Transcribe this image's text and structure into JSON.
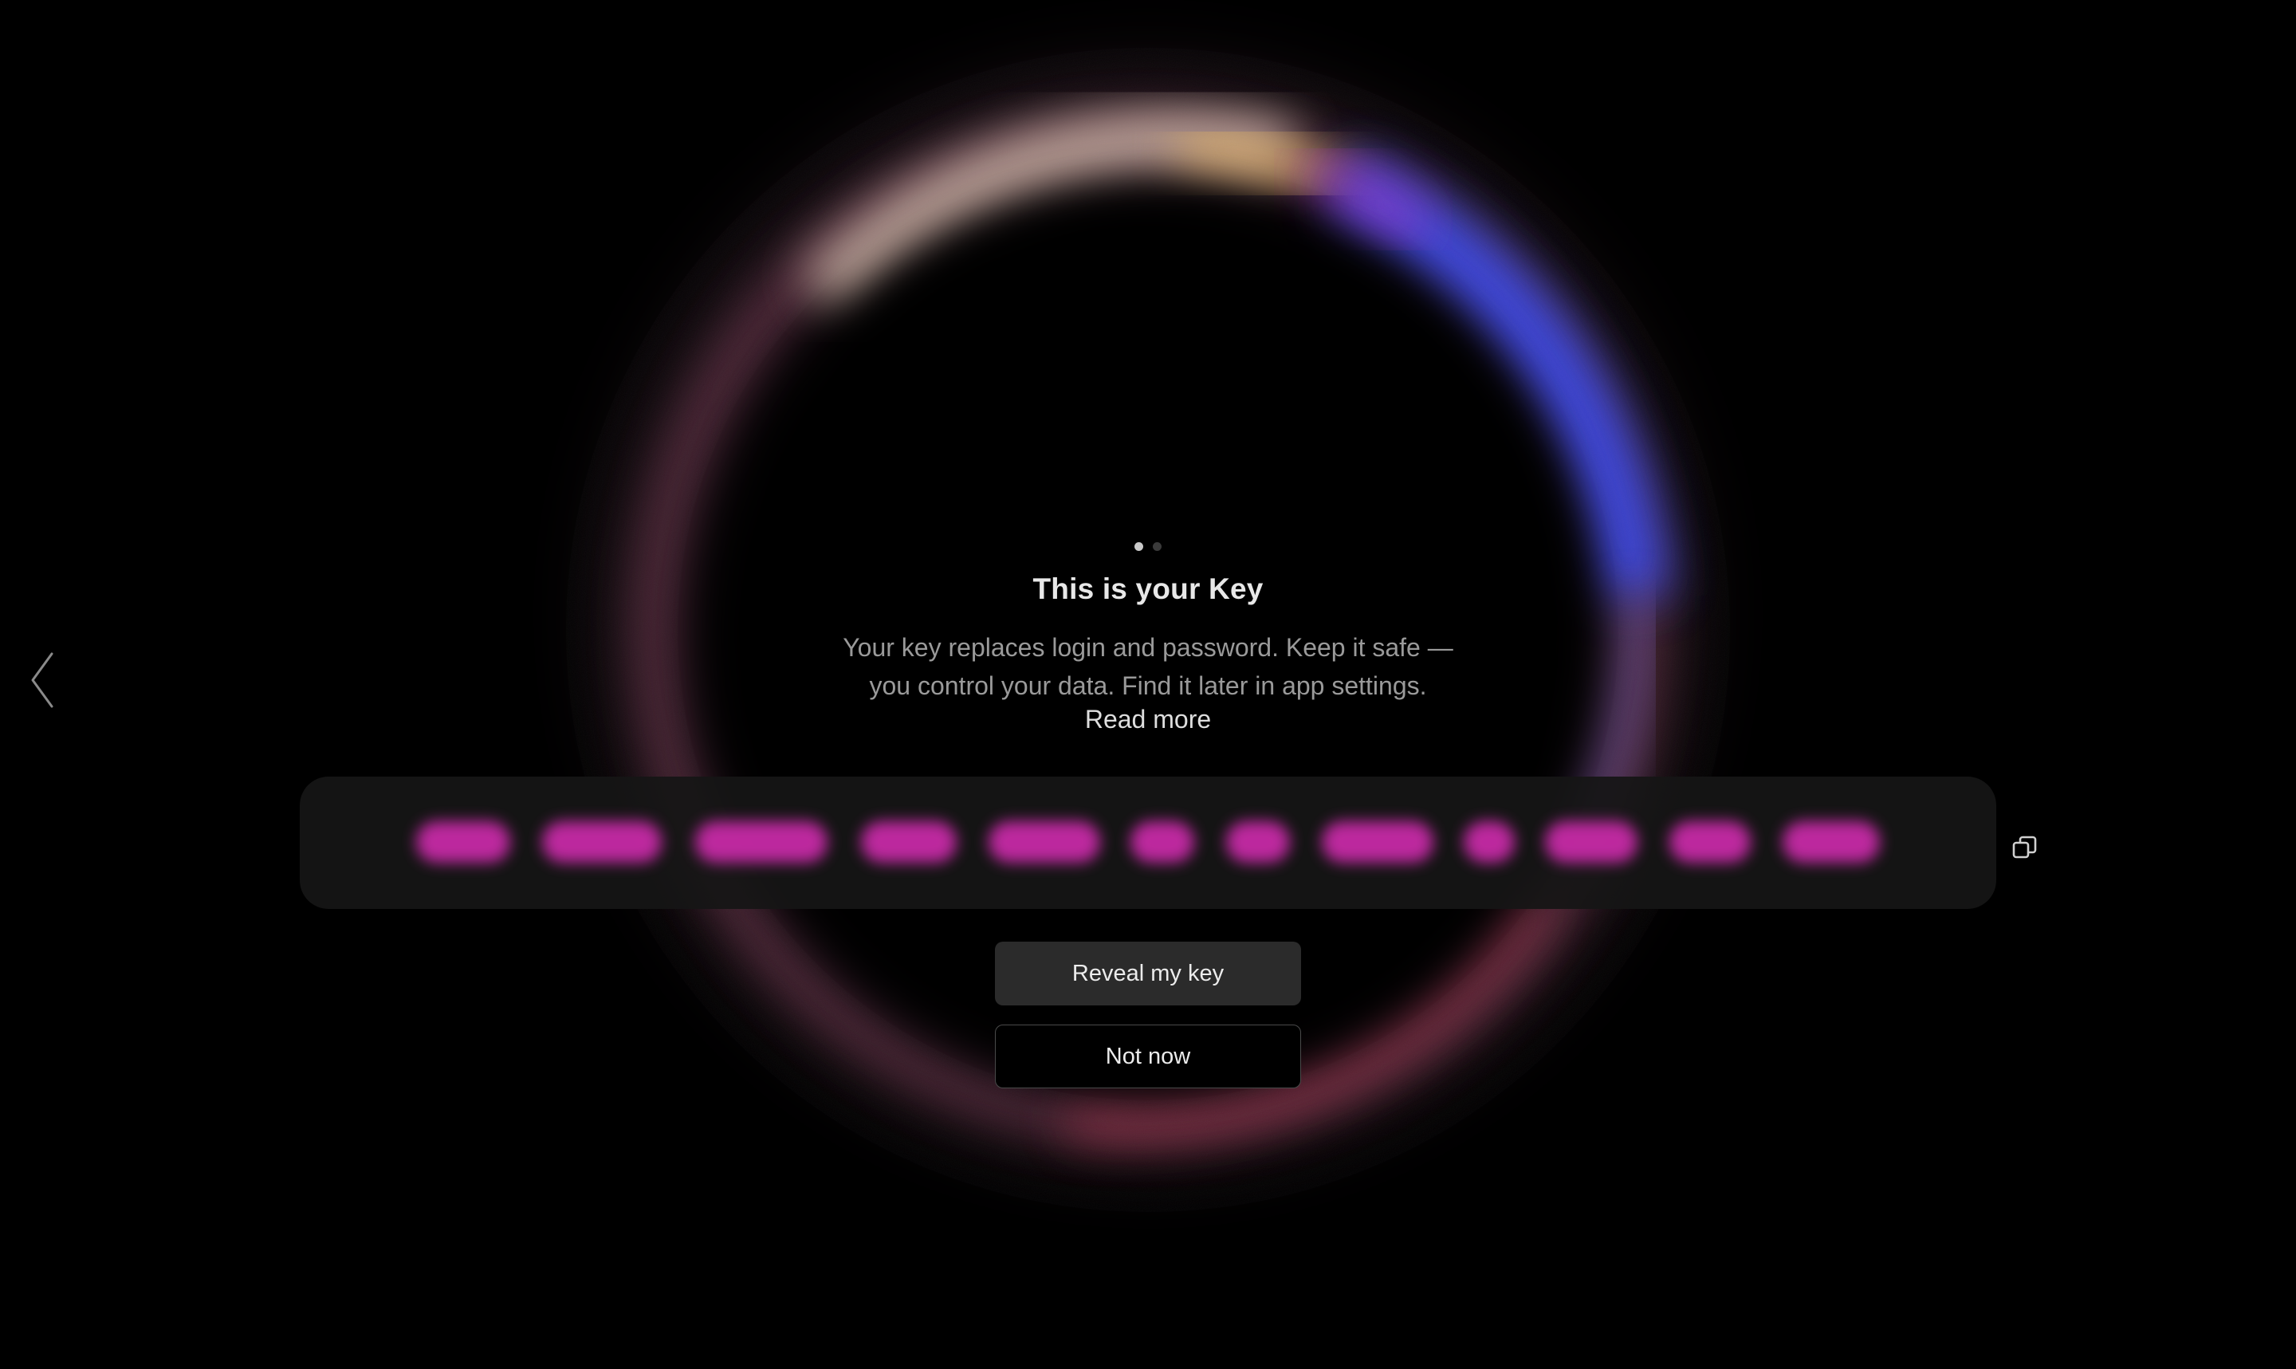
{
  "onboarding": {
    "pagination": {
      "total": 2,
      "current": 1
    },
    "title": "This is your Key",
    "description_line1": "Your key replaces login and password. Keep it safe —",
    "description_line2": "you control your data. Find it later in app settings.",
    "read_more": "Read more",
    "key_hidden": true,
    "reveal_button": "Reveal my key",
    "not_now_button": "Not now"
  },
  "icons": {
    "back": "chevron-left-icon",
    "copy": "copy-icon"
  },
  "colors": {
    "background": "#000000",
    "key_blur": "#c62aa6",
    "ring_blue": "#3a44e0",
    "ring_pink": "#c04a7a",
    "ring_gold": "#c8a050"
  }
}
